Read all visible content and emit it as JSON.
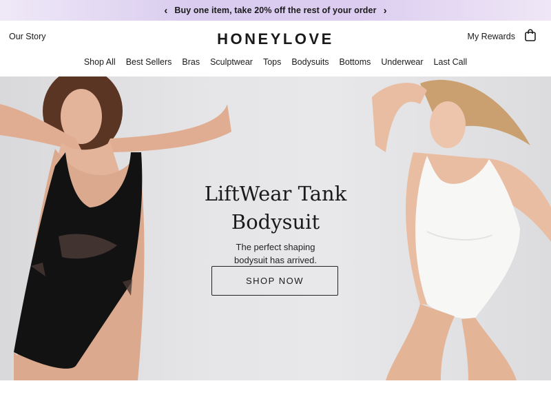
{
  "promo": {
    "prev_icon": "chevron-left-icon",
    "text": "Buy one item, take 20% off the rest of your order",
    "next_icon": "chevron-right-icon"
  },
  "header": {
    "our_story": "Our Story",
    "logo": "HONEYLOVE",
    "rewards": "My Rewards",
    "bag_icon": "shopping-bag-icon"
  },
  "nav": {
    "items": [
      "Shop All",
      "Best Sellers",
      "Bras",
      "Sculptwear",
      "Tops",
      "Bodysuits",
      "Bottoms",
      "Underwear",
      "Last Call"
    ]
  },
  "hero": {
    "title_line1": "LiftWear Tank",
    "title_line2": "Bodysuit",
    "subtitle_line1": "The perfect shaping",
    "subtitle_line2": "bodysuit has arrived.",
    "cta": "SHOP NOW"
  },
  "colors": {
    "promo_gradient": "#d9ccef",
    "hero_background": "#e6e6e8",
    "text": "#1a1a1a"
  }
}
